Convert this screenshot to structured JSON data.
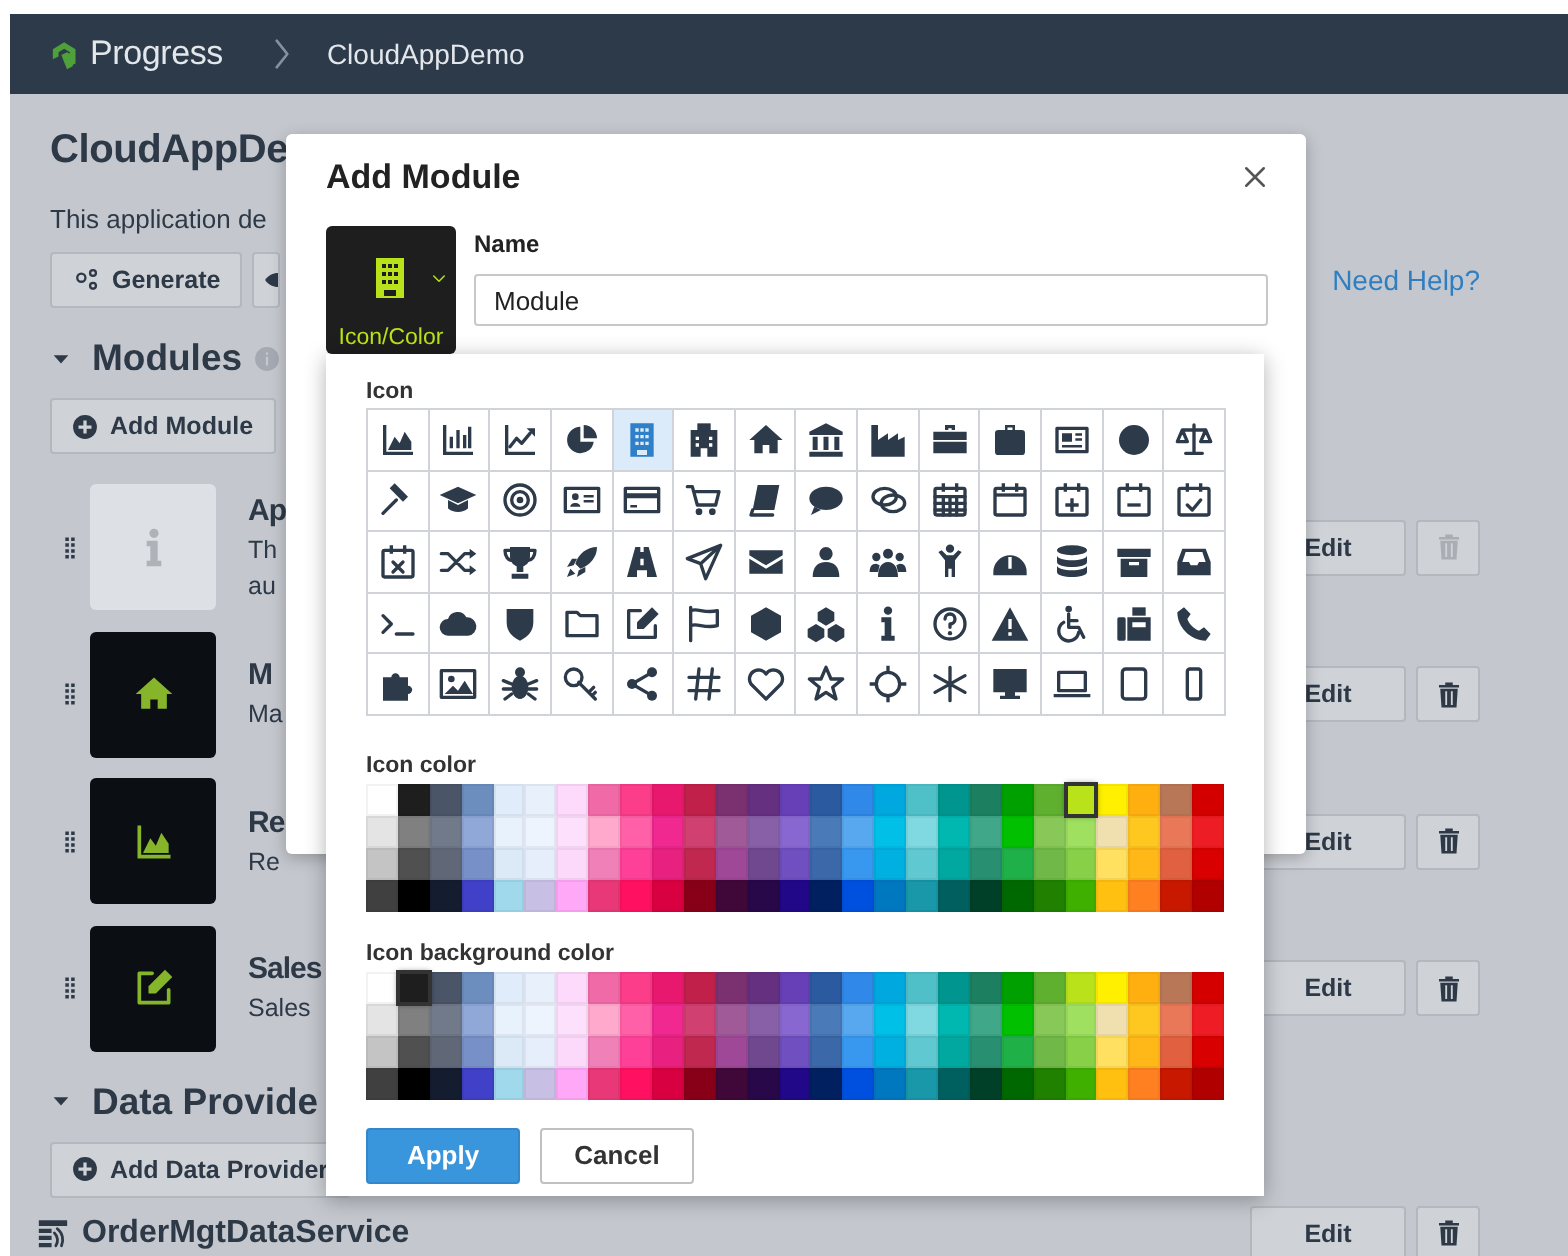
{
  "header": {
    "brand": "Progress",
    "breadcrumb": "CloudAppDemo"
  },
  "page": {
    "title": "CloudAppDe",
    "description": "This application de",
    "generate_button": "Generate",
    "help_link": "Need Help?",
    "sections": [
      {
        "title": "Modules",
        "expanded": true,
        "add_button": "Add Module",
        "items": [
          {
            "kind": "tile",
            "title": "Ap",
            "description_lines": [
              "Th",
              "au"
            ],
            "color": "#dde0e4",
            "edit_button": "Edit",
            "delete_disabled": true
          },
          {
            "kind": "tile",
            "title": "M",
            "description_lines": [
              "Ma"
            ],
            "color": "#0b0e13",
            "edit_button": "Edit",
            "delete_disabled": false
          },
          {
            "kind": "tile",
            "title": "Re",
            "description_lines": [
              "Re"
            ],
            "color": "#0b0e13",
            "edit_button": "Edit",
            "delete_disabled": false
          },
          {
            "kind": "tile",
            "title": "Sales",
            "description_lines": [
              "Sales"
            ],
            "color": "#0b0e13",
            "edit_button": "Edit",
            "delete_disabled": false
          }
        ]
      },
      {
        "title": "Data Provide",
        "expanded": true,
        "add_button": "Add Data Provider",
        "items": [
          {
            "kind": "service",
            "title": "OrderMgtDataService",
            "edit_button": "Edit",
            "delete_disabled": false
          }
        ]
      }
    ]
  },
  "modal": {
    "title": "Add Module",
    "icon_button_label": "Icon/Color",
    "name_label": "Name",
    "name_value": "Module",
    "picker": {
      "icon_label": "Icon",
      "icons": [
        {
          "selected": false
        },
        {
          "selected": false
        },
        {
          "selected": false
        },
        {
          "selected": false
        },
        {
          "selected": true
        },
        {
          "selected": false
        },
        {
          "selected": false
        },
        {
          "selected": false
        },
        {
          "selected": false
        },
        {
          "selected": false
        },
        {
          "selected": false
        },
        {
          "selected": false
        },
        {
          "selected": false
        },
        {
          "selected": false
        },
        {
          "selected": false
        },
        {
          "selected": false
        },
        {
          "selected": false
        },
        {
          "selected": false
        },
        {
          "selected": false
        },
        {
          "selected": false
        },
        {
          "selected": false
        },
        {
          "selected": false
        },
        {
          "selected": false
        },
        {
          "selected": false
        },
        {
          "selected": false
        },
        {
          "selected": false
        },
        {
          "selected": false
        },
        {
          "selected": false
        },
        {
          "selected": false
        },
        {
          "selected": false
        },
        {
          "selected": false
        },
        {
          "selected": false
        },
        {
          "selected": false
        },
        {
          "selected": false
        },
        {
          "selected": false
        },
        {
          "selected": false
        },
        {
          "selected": false
        },
        {
          "selected": false
        },
        {
          "selected": false
        },
        {
          "selected": false
        },
        {
          "selected": false
        },
        {
          "selected": false
        },
        {
          "selected": false
        },
        {
          "selected": false
        },
        {
          "selected": false
        },
        {
          "selected": false
        },
        {
          "selected": false
        },
        {
          "selected": false
        },
        {
          "selected": false
        },
        {
          "selected": false
        },
        {
          "selected": false
        },
        {
          "selected": false
        },
        {
          "selected": false
        },
        {
          "selected": false
        },
        {
          "selected": false
        },
        {
          "selected": false
        },
        {
          "selected": false
        },
        {
          "selected": false
        },
        {
          "selected": false
        },
        {
          "selected": false
        },
        {
          "selected": false
        },
        {
          "selected": false
        },
        {
          "selected": false
        },
        {
          "selected": false
        },
        {
          "selected": false
        },
        {
          "selected": false
        },
        {
          "selected": false
        },
        {
          "selected": false
        },
        {
          "selected": false
        },
        {
          "selected": false
        }
      ],
      "icon_color_label": "Icon color",
      "icon_colors": [
        {
          "swatches": [
            {
              "color": "#ffffff",
              "selected": false
            },
            {
              "color": "#1e1e1e",
              "selected": false
            },
            {
              "color": "#4a5568",
              "selected": false
            },
            {
              "color": "#6c8ebf",
              "selected": false
            },
            {
              "color": "#e0ecfa",
              "selected": false
            },
            {
              "color": "#e8f0fc",
              "selected": false
            },
            {
              "color": "#fdd9fb",
              "selected": false
            },
            {
              "color": "#f06aa8",
              "selected": false
            },
            {
              "color": "#fb3d8a",
              "selected": false
            },
            {
              "color": "#e8186e",
              "selected": false
            },
            {
              "color": "#c0204a",
              "selected": false
            },
            {
              "color": "#7b3070",
              "selected": false
            },
            {
              "color": "#653080",
              "selected": false
            },
            {
              "color": "#6740b8",
              "selected": false
            },
            {
              "color": "#2b5aa0",
              "selected": false
            },
            {
              "color": "#3088e8",
              "selected": false
            },
            {
              "color": "#00a8e0",
              "selected": false
            },
            {
              "color": "#50c0c8",
              "selected": false
            },
            {
              "color": "#00968f",
              "selected": false
            },
            {
              "color": "#1c8060",
              "selected": false
            },
            {
              "color": "#00a000",
              "selected": false
            },
            {
              "color": "#60b030",
              "selected": false
            },
            {
              "color": "#b9e21a",
              "selected": true
            },
            {
              "color": "#fff000",
              "selected": false
            },
            {
              "color": "#ffb010",
              "selected": false
            },
            {
              "color": "#b87858",
              "selected": false
            },
            {
              "color": "#d40000",
              "selected": false
            }
          ]
        },
        {
          "swatches": [
            {
              "color": "#e4e4e4",
              "selected": false
            },
            {
              "color": "#808080",
              "selected": false
            },
            {
              "color": "#707a8a",
              "selected": false
            },
            {
              "color": "#90a8d8",
              "selected": false
            },
            {
              "color": "#e8f2fc",
              "selected": false
            },
            {
              "color": "#eef4fe",
              "selected": false
            },
            {
              "color": "#fde0fc",
              "selected": false
            },
            {
              "color": "#ffaacc",
              "selected": false
            },
            {
              "color": "#ff60a8",
              "selected": false
            },
            {
              "color": "#f02890",
              "selected": false
            },
            {
              "color": "#d04070",
              "selected": false
            },
            {
              "color": "#a05a98",
              "selected": false
            },
            {
              "color": "#8860a8",
              "selected": false
            },
            {
              "color": "#8868d0",
              "selected": false
            },
            {
              "color": "#4a7ab8",
              "selected": false
            },
            {
              "color": "#58a8f0",
              "selected": false
            },
            {
              "color": "#00c0e8",
              "selected": false
            },
            {
              "color": "#80d8e0",
              "selected": false
            },
            {
              "color": "#00b8b0",
              "selected": false
            },
            {
              "color": "#40a888",
              "selected": false
            },
            {
              "color": "#00c000",
              "selected": false
            },
            {
              "color": "#88c858",
              "selected": false
            },
            {
              "color": "#a0e060",
              "selected": false
            },
            {
              "color": "#f0e0b0",
              "selected": false
            },
            {
              "color": "#ffc820",
              "selected": false
            },
            {
              "color": "#e87858",
              "selected": false
            },
            {
              "color": "#ee1c24",
              "selected": false
            }
          ]
        },
        {
          "swatches": [
            {
              "color": "#c4c4c4",
              "selected": false
            },
            {
              "color": "#505050",
              "selected": false
            },
            {
              "color": "#606878",
              "selected": false
            },
            {
              "color": "#7890c8",
              "selected": false
            },
            {
              "color": "#dceaf8",
              "selected": false
            },
            {
              "color": "#e6eefc",
              "selected": false
            },
            {
              "color": "#fcd8fa",
              "selected": false
            },
            {
              "color": "#f080b8",
              "selected": false
            },
            {
              "color": "#ff4098",
              "selected": false
            },
            {
              "color": "#e82080",
              "selected": false
            },
            {
              "color": "#c02850",
              "selected": false
            },
            {
              "color": "#a04898",
              "selected": false
            },
            {
              "color": "#704890",
              "selected": false
            },
            {
              "color": "#7050c0",
              "selected": false
            },
            {
              "color": "#3a68a8",
              "selected": false
            },
            {
              "color": "#3898f0",
              "selected": false
            },
            {
              "color": "#00b0e0",
              "selected": false
            },
            {
              "color": "#60c8d0",
              "selected": false
            },
            {
              "color": "#00a8a0",
              "selected": false
            },
            {
              "color": "#289070",
              "selected": false
            },
            {
              "color": "#20b048",
              "selected": false
            },
            {
              "color": "#70b848",
              "selected": false
            },
            {
              "color": "#88d048",
              "selected": false
            },
            {
              "color": "#ffe060",
              "selected": false
            },
            {
              "color": "#ffb818",
              "selected": false
            },
            {
              "color": "#e06040",
              "selected": false
            },
            {
              "color": "#d80000",
              "selected": false
            }
          ]
        },
        {
          "swatches": [
            {
              "color": "#404040",
              "selected": false
            },
            {
              "color": "#000000",
              "selected": false
            },
            {
              "color": "#141c30",
              "selected": false
            },
            {
              "color": "#4040c8",
              "selected": false
            },
            {
              "color": "#a0d8ec",
              "selected": false
            },
            {
              "color": "#c8c0e4",
              "selected": false
            },
            {
              "color": "#ffa8f8",
              "selected": false
            },
            {
              "color": "#e83878",
              "selected": false
            },
            {
              "color": "#ff1060",
              "selected": false
            },
            {
              "color": "#d80040",
              "selected": false
            },
            {
              "color": "#880018",
              "selected": false
            },
            {
              "color": "#400838",
              "selected": false
            },
            {
              "color": "#280848",
              "selected": false
            },
            {
              "color": "#200888",
              "selected": false
            },
            {
              "color": "#002060",
              "selected": false
            },
            {
              "color": "#0050e0",
              "selected": false
            },
            {
              "color": "#0078c0",
              "selected": false
            },
            {
              "color": "#1898a8",
              "selected": false
            },
            {
              "color": "#006060",
              "selected": false
            },
            {
              "color": "#004028",
              "selected": false
            },
            {
              "color": "#006800",
              "selected": false
            },
            {
              "color": "#208000",
              "selected": false
            },
            {
              "color": "#40b000",
              "selected": false
            },
            {
              "color": "#ffc010",
              "selected": false
            },
            {
              "color": "#ff8020",
              "selected": false
            },
            {
              "color": "#c81800",
              "selected": false
            },
            {
              "color": "#b00000",
              "selected": false
            }
          ]
        }
      ],
      "bg_color_label": "Icon background color",
      "bg_colors": [
        {
          "swatches": [
            {
              "color": "#ffffff",
              "selected": false
            },
            {
              "color": "#1e1e1e",
              "selected": true
            },
            {
              "color": "#4a5568",
              "selected": false
            },
            {
              "color": "#6c8ebf",
              "selected": false
            },
            {
              "color": "#e0ecfa",
              "selected": false
            },
            {
              "color": "#e8f0fc",
              "selected": false
            },
            {
              "color": "#fdd9fb",
              "selected": false
            },
            {
              "color": "#f06aa8",
              "selected": false
            },
            {
              "color": "#fb3d8a",
              "selected": false
            },
            {
              "color": "#e8186e",
              "selected": false
            },
            {
              "color": "#c0204a",
              "selected": false
            },
            {
              "color": "#7b3070",
              "selected": false
            },
            {
              "color": "#653080",
              "selected": false
            },
            {
              "color": "#6740b8",
              "selected": false
            },
            {
              "color": "#2b5aa0",
              "selected": false
            },
            {
              "color": "#3088e8",
              "selected": false
            },
            {
              "color": "#00a8e0",
              "selected": false
            },
            {
              "color": "#50c0c8",
              "selected": false
            },
            {
              "color": "#00968f",
              "selected": false
            },
            {
              "color": "#1c8060",
              "selected": false
            },
            {
              "color": "#00a000",
              "selected": false
            },
            {
              "color": "#60b030",
              "selected": false
            },
            {
              "color": "#b9e21a",
              "selected": false
            },
            {
              "color": "#fff000",
              "selected": false
            },
            {
              "color": "#ffb010",
              "selected": false
            },
            {
              "color": "#b87858",
              "selected": false
            },
            {
              "color": "#d40000",
              "selected": false
            }
          ]
        },
        {
          "swatches": [
            {
              "color": "#e4e4e4",
              "selected": false
            },
            {
              "color": "#808080",
              "selected": false
            },
            {
              "color": "#707a8a",
              "selected": false
            },
            {
              "color": "#90a8d8",
              "selected": false
            },
            {
              "color": "#e8f2fc",
              "selected": false
            },
            {
              "color": "#eef4fe",
              "selected": false
            },
            {
              "color": "#fde0fc",
              "selected": false
            },
            {
              "color": "#ffaacc",
              "selected": false
            },
            {
              "color": "#ff60a8",
              "selected": false
            },
            {
              "color": "#f02890",
              "selected": false
            },
            {
              "color": "#d04070",
              "selected": false
            },
            {
              "color": "#a05a98",
              "selected": false
            },
            {
              "color": "#8860a8",
              "selected": false
            },
            {
              "color": "#8868d0",
              "selected": false
            },
            {
              "color": "#4a7ab8",
              "selected": false
            },
            {
              "color": "#58a8f0",
              "selected": false
            },
            {
              "color": "#00c0e8",
              "selected": false
            },
            {
              "color": "#80d8e0",
              "selected": false
            },
            {
              "color": "#00b8b0",
              "selected": false
            },
            {
              "color": "#40a888",
              "selected": false
            },
            {
              "color": "#00c000",
              "selected": false
            },
            {
              "color": "#88c858",
              "selected": false
            },
            {
              "color": "#a0e060",
              "selected": false
            },
            {
              "color": "#f0e0b0",
              "selected": false
            },
            {
              "color": "#ffc820",
              "selected": false
            },
            {
              "color": "#e87858",
              "selected": false
            },
            {
              "color": "#ee1c24",
              "selected": false
            }
          ]
        },
        {
          "swatches": [
            {
              "color": "#c4c4c4",
              "selected": false
            },
            {
              "color": "#505050",
              "selected": false
            },
            {
              "color": "#606878",
              "selected": false
            },
            {
              "color": "#7890c8",
              "selected": false
            },
            {
              "color": "#dceaf8",
              "selected": false
            },
            {
              "color": "#e6eefc",
              "selected": false
            },
            {
              "color": "#fcd8fa",
              "selected": false
            },
            {
              "color": "#f080b8",
              "selected": false
            },
            {
              "color": "#ff4098",
              "selected": false
            },
            {
              "color": "#e82080",
              "selected": false
            },
            {
              "color": "#c02850",
              "selected": false
            },
            {
              "color": "#a04898",
              "selected": false
            },
            {
              "color": "#704890",
              "selected": false
            },
            {
              "color": "#7050c0",
              "selected": false
            },
            {
              "color": "#3a68a8",
              "selected": false
            },
            {
              "color": "#3898f0",
              "selected": false
            },
            {
              "color": "#00b0e0",
              "selected": false
            },
            {
              "color": "#60c8d0",
              "selected": false
            },
            {
              "color": "#00a8a0",
              "selected": false
            },
            {
              "color": "#289070",
              "selected": false
            },
            {
              "color": "#20b048",
              "selected": false
            },
            {
              "color": "#70b848",
              "selected": false
            },
            {
              "color": "#88d048",
              "selected": false
            },
            {
              "color": "#ffe060",
              "selected": false
            },
            {
              "color": "#ffb818",
              "selected": false
            },
            {
              "color": "#e06040",
              "selected": false
            },
            {
              "color": "#d80000",
              "selected": false
            }
          ]
        },
        {
          "swatches": [
            {
              "color": "#404040",
              "selected": false
            },
            {
              "color": "#000000",
              "selected": false
            },
            {
              "color": "#141c30",
              "selected": false
            },
            {
              "color": "#4040c8",
              "selected": false
            },
            {
              "color": "#a0d8ec",
              "selected": false
            },
            {
              "color": "#c8c0e4",
              "selected": false
            },
            {
              "color": "#ffa8f8",
              "selected": false
            },
            {
              "color": "#e83878",
              "selected": false
            },
            {
              "color": "#ff1060",
              "selected": false
            },
            {
              "color": "#d80040",
              "selected": false
            },
            {
              "color": "#880018",
              "selected": false
            },
            {
              "color": "#400838",
              "selected": false
            },
            {
              "color": "#280848",
              "selected": false
            },
            {
              "color": "#200888",
              "selected": false
            },
            {
              "color": "#002060",
              "selected": false
            },
            {
              "color": "#0050e0",
              "selected": false
            },
            {
              "color": "#0078c0",
              "selected": false
            },
            {
              "color": "#1898a8",
              "selected": false
            },
            {
              "color": "#006060",
              "selected": false
            },
            {
              "color": "#004028",
              "selected": false
            },
            {
              "color": "#006800",
              "selected": false
            },
            {
              "color": "#208000",
              "selected": false
            },
            {
              "color": "#40b000",
              "selected": false
            },
            {
              "color": "#ffc010",
              "selected": false
            },
            {
              "color": "#ff8020",
              "selected": false
            },
            {
              "color": "#c81800",
              "selected": false
            },
            {
              "color": "#b00000",
              "selected": false
            }
          ]
        }
      ],
      "apply_button": "Apply",
      "cancel_button": "Cancel"
    }
  }
}
